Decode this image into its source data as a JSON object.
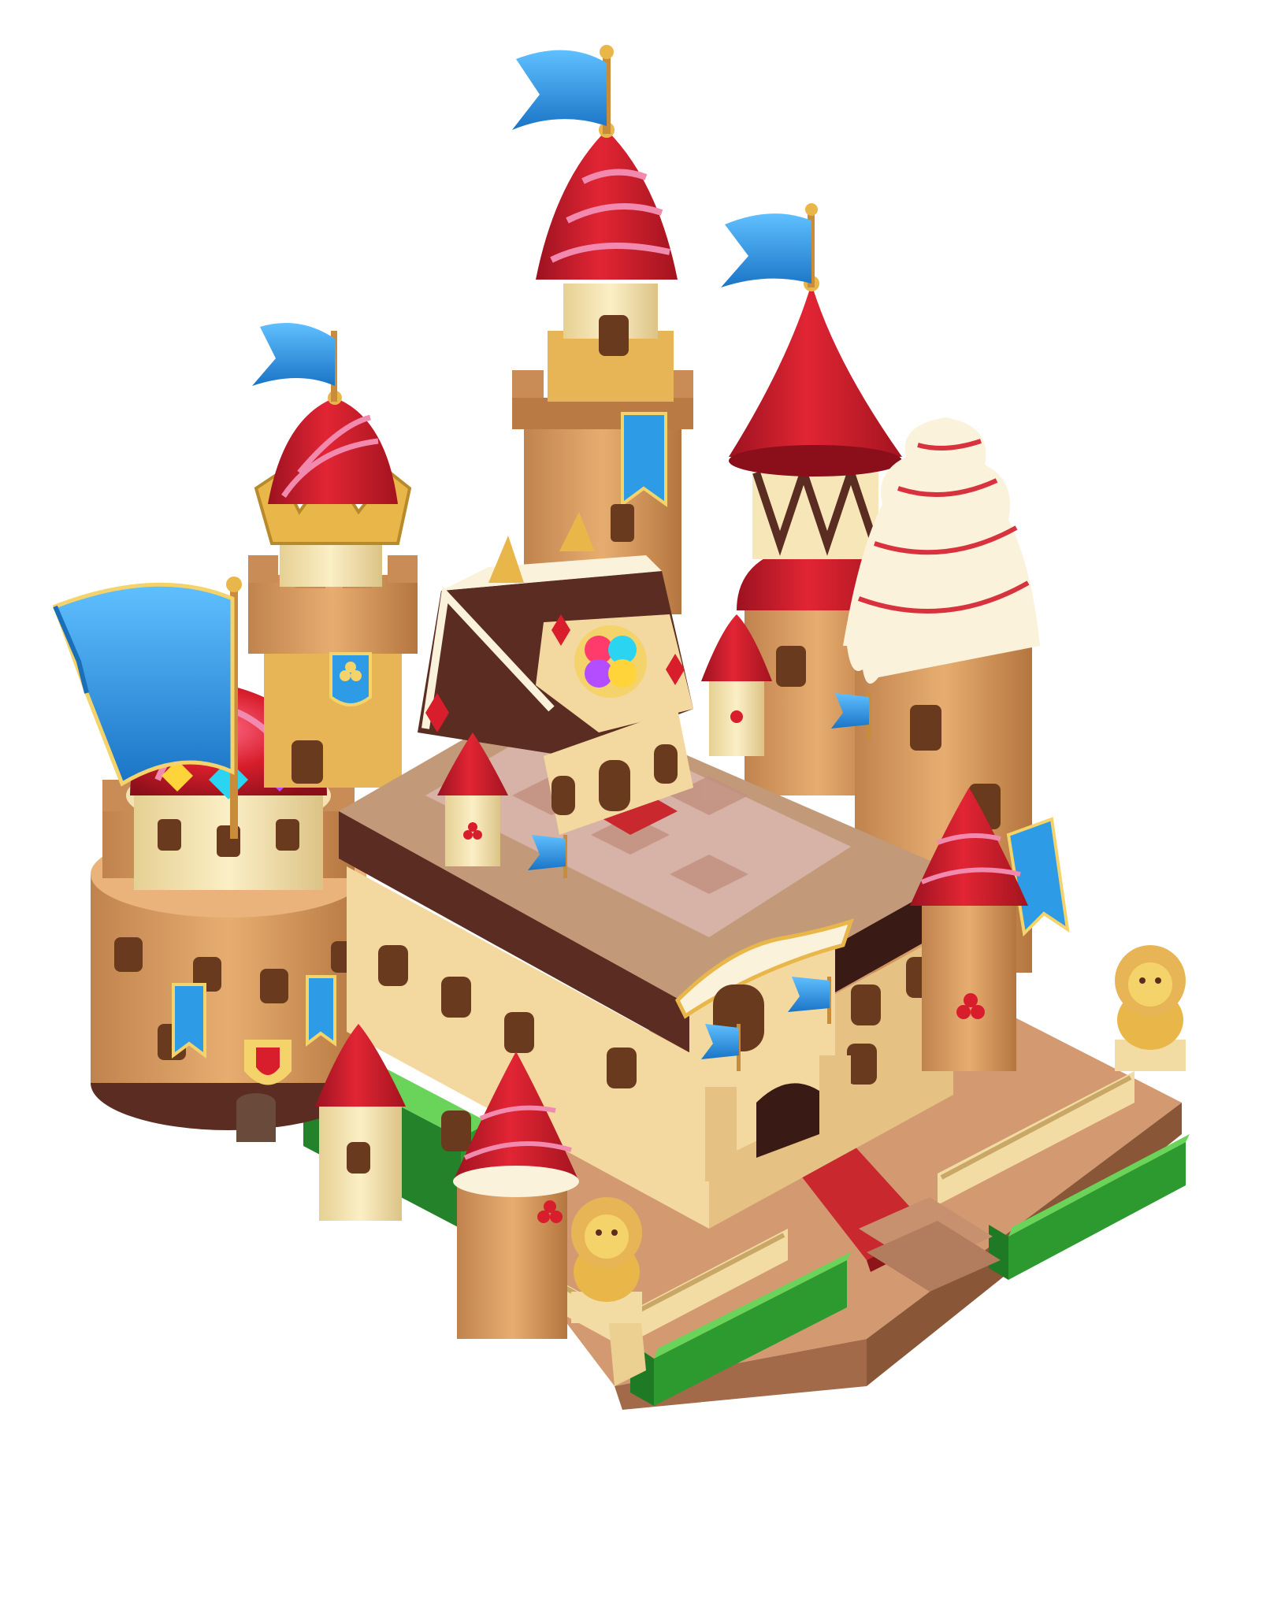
{
  "scene": {
    "subject": "castle-building-sprite",
    "background": "#ffffff"
  },
  "palette": {
    "roof_red": "#d81e2c",
    "roof_red_dark": "#9c1220",
    "roof_stripe": "#f28ab0",
    "flag_blue": "#2e9be6",
    "flag_blue_dark": "#1a6fb8",
    "flag_trim": "#f5d36b",
    "biscuit": "#e2a466",
    "biscuit_dark": "#b97a44",
    "cream": "#f7e7b8",
    "chocolate": "#5a2c22",
    "chocolate_dark": "#3a1a14",
    "gold": "#e9b64a",
    "hedge": "#3fae3a",
    "hedge_dark": "#23822a",
    "carpet": "#c8282e",
    "plaza": "#d9a07a",
    "window": "#6a3a1e",
    "gem_colors": [
      "#ff3b6b",
      "#2bd4f0",
      "#ffd43b",
      "#b44cff"
    ]
  },
  "icons": {
    "flags": "pennant-flag-icon",
    "club_symbol": "club-icon",
    "lion_statue": "lion-statue-icon",
    "heart_crest": "heart-crest-icon"
  }
}
